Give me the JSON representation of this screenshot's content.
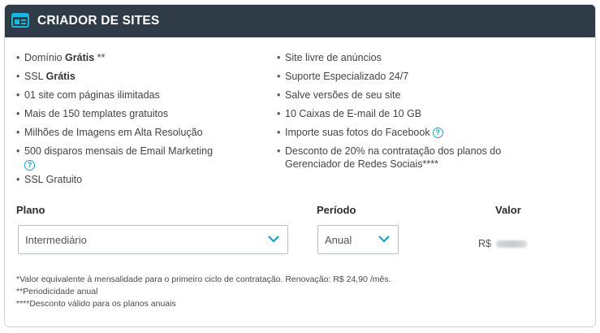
{
  "header": {
    "title": "CRIADOR DE SITES",
    "icon": "site-builder-icon"
  },
  "features_left": [
    {
      "pre": "Domínio ",
      "bold": "Grátis",
      "post": " **"
    },
    {
      "pre": "SSL ",
      "bold": "Grátis",
      "post": ""
    },
    {
      "pre": "01 site com páginas ilimitadas",
      "bold": "",
      "post": ""
    },
    {
      "pre": "Mais de 150 templates gratuitos",
      "bold": "",
      "post": ""
    },
    {
      "pre": "Milhões de Imagens em Alta Resolução",
      "bold": "",
      "post": ""
    },
    {
      "pre": "500 disparos mensais de Email Marketing",
      "bold": "",
      "post": ""
    },
    {
      "pre": "SSL Gratuito",
      "bold": "",
      "post": ""
    }
  ],
  "features_right": [
    "Site livre de anúncios",
    "Suporte Especializado 24/7",
    "Salve versões de seu site",
    "10 Caixas de E-mail de 10 GB",
    "Importe suas fotos do Facebook",
    "Desconto de 20% na contratação dos planos do Gerenciador de Redes Sociais****"
  ],
  "help_glyph": "?",
  "form": {
    "plano_label": "Plano",
    "plano_value": "Intermediário",
    "periodo_label": "Período",
    "periodo_value": "Anual",
    "valor_label": "Valor",
    "currency": "R$"
  },
  "notes": [
    "*Valor equivalente à mensalidade para o primeiro ciclo de contratação. Renovação: R$ 24,90 /mês.",
    "**Periodicidade anual",
    "****Desconto válido para os planos anuais"
  ],
  "colors": {
    "header_bg": "#2f3b47",
    "accent": "#13a3c4"
  }
}
